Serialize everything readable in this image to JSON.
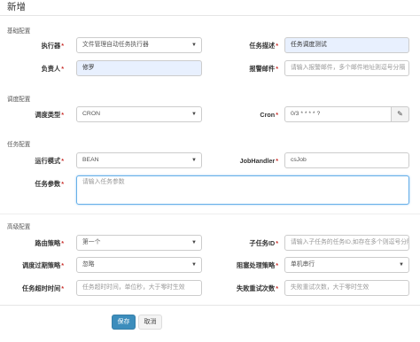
{
  "dialog": {
    "title": "新增"
  },
  "sections": {
    "base": "基础配置",
    "schedule": "调度配置",
    "task": "任务配置",
    "advanced": "高级配置"
  },
  "fields": {
    "executor": {
      "label": "执行器",
      "value": "文件管理自动任务执行器"
    },
    "job_desc": {
      "label": "任务描述",
      "value": "任务调度测试"
    },
    "author": {
      "label": "负责人",
      "value": "修罗"
    },
    "alarm_email": {
      "label": "报警邮件",
      "placeholder": "请输入报警邮件，多个邮件地址则逗号分隔"
    },
    "schedule_type": {
      "label": "调度类型",
      "value": "CRON"
    },
    "cron": {
      "label": "Cron",
      "value": "0/3 * * * * ?"
    },
    "run_mode": {
      "label": "运行模式",
      "value": "BEAN"
    },
    "job_handler": {
      "label": "JobHandler",
      "value": "csJob"
    },
    "job_param": {
      "label": "任务参数",
      "placeholder": "请输入任务参数"
    },
    "route_strategy": {
      "label": "路由策略",
      "value": "第一个"
    },
    "child_job_id": {
      "label": "子任务ID",
      "placeholder": "请输入子任务的任务ID,如存在多个则逗号分隔"
    },
    "misfire_strategy": {
      "label": "调度过期策略",
      "value": "忽略"
    },
    "block_strategy": {
      "label": "阻塞处理策略",
      "value": "单机串行"
    },
    "timeout": {
      "label": "任务超时时间",
      "placeholder": "任务超时时间，单位秒，大于零时生效"
    },
    "fail_retry": {
      "label": "失败重试次数",
      "placeholder": "失败重试次数，大于零时生效"
    }
  },
  "buttons": {
    "save": "保存",
    "cancel": "取消"
  },
  "colors": {
    "primary": "#3c8dbc",
    "required": "#c9302c",
    "autofill": "#e8f0fe",
    "focus": "#66afe9"
  },
  "icons": {
    "select_arrow": "chevron-down-icon",
    "cron_edit": "edit-icon"
  }
}
